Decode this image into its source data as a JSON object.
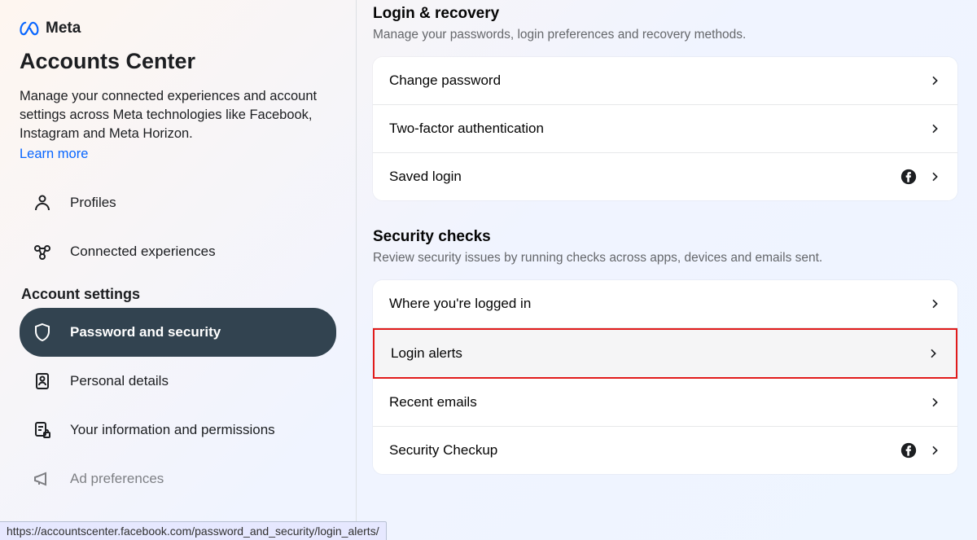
{
  "header": {
    "brand": "Meta",
    "title": "Accounts Center",
    "description": "Manage your connected experiences and account settings across Meta technologies like Facebook, Instagram and Meta Horizon.",
    "learn_more": "Learn more"
  },
  "sidebar": {
    "top_items": [
      {
        "label": "Profiles"
      },
      {
        "label": "Connected experiences"
      }
    ],
    "section_label": "Account settings",
    "settings_items": [
      {
        "label": "Password and security",
        "active": true
      },
      {
        "label": "Personal details"
      },
      {
        "label": "Your information and permissions"
      },
      {
        "label": "Ad preferences"
      }
    ]
  },
  "main": {
    "sections": [
      {
        "title": "Login & recovery",
        "description": "Manage your passwords, login preferences and recovery methods.",
        "rows": [
          {
            "label": "Change password",
            "fb_badge": false
          },
          {
            "label": "Two-factor authentication",
            "fb_badge": false
          },
          {
            "label": "Saved login",
            "fb_badge": true
          }
        ]
      },
      {
        "title": "Security checks",
        "description": "Review security issues by running checks across apps, devices and emails sent.",
        "rows": [
          {
            "label": "Where you're logged in",
            "fb_badge": false
          },
          {
            "label": "Login alerts",
            "fb_badge": false,
            "highlighted": true
          },
          {
            "label": "Recent emails",
            "fb_badge": false
          },
          {
            "label": "Security Checkup",
            "fb_badge": true
          }
        ]
      }
    ]
  },
  "status_bar": {
    "url": "https://accountscenter.facebook.com/password_and_security/login_alerts/"
  }
}
